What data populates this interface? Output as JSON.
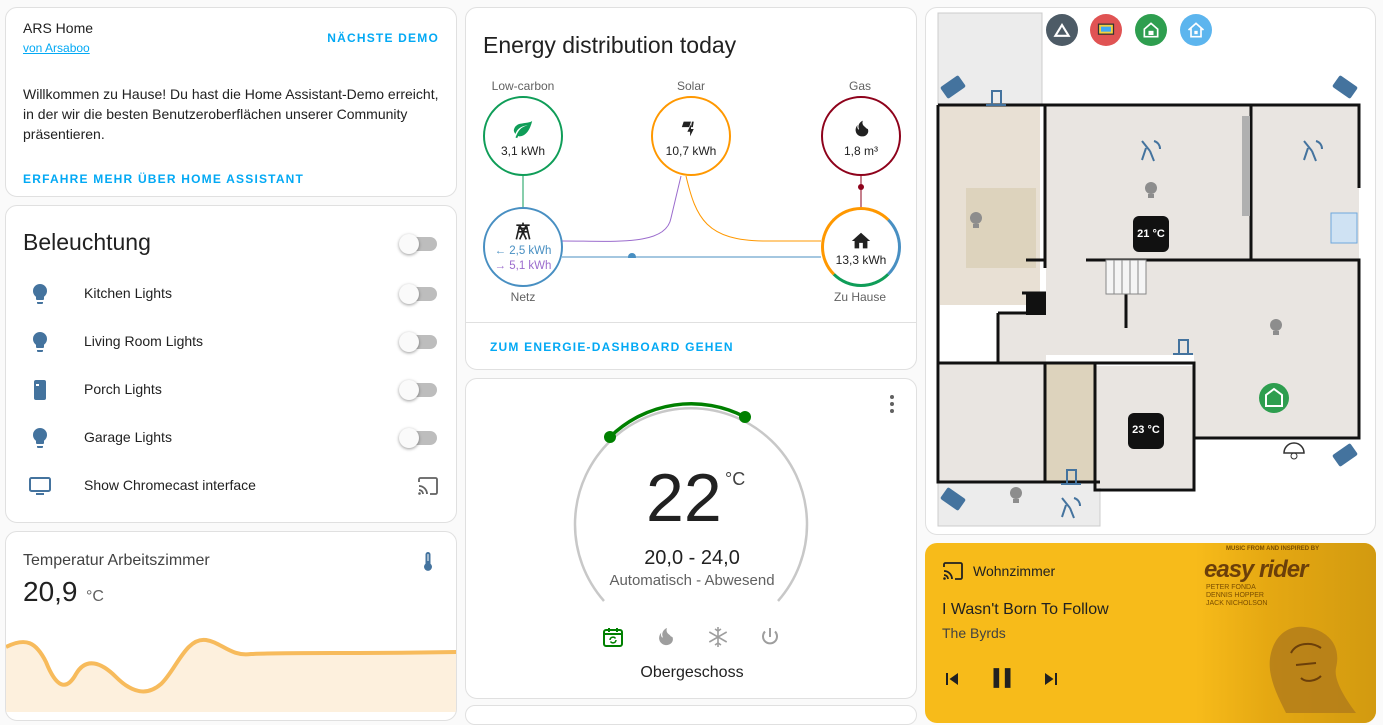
{
  "intro": {
    "title": "ARS Home",
    "author_link": "von Arsaboo",
    "next_demo": "NÄCHSTE DEMO",
    "description": "Willkommen zu Hause! Du hast die Home Assistant-Demo erreicht, in der wir die besten Benutzeroberflächen unserer Community präsentieren.",
    "learn_more": "ERFAHRE MEHR ÜBER HOME ASSISTANT"
  },
  "lights": {
    "title": "Beleuchtung",
    "items": [
      {
        "label": "Kitchen Lights",
        "icon": "lightbulb-icon"
      },
      {
        "label": "Living Room Lights",
        "icon": "lightbulb-icon"
      },
      {
        "label": "Porch Lights",
        "icon": "outdoor-lamp-icon"
      },
      {
        "label": "Garage Lights",
        "icon": "lightbulb-icon"
      },
      {
        "label": "Show Chromecast interface",
        "icon": "television-icon"
      }
    ]
  },
  "temperature": {
    "title": "Temperatur Arbeitszimmer",
    "value": "20,9",
    "unit": "°C"
  },
  "energy": {
    "title": "Energy distribution today",
    "low_carbon": {
      "label": "Low-carbon",
      "value": "3,1 kWh"
    },
    "solar": {
      "label": "Solar",
      "value": "10,7 kWh"
    },
    "gas": {
      "label": "Gas",
      "value": "1,8 m³"
    },
    "grid": {
      "label": "Netz",
      "import": "2,5 kWh",
      "export": "5,1 kWh"
    },
    "home": {
      "label": "Zu Hause",
      "value": "13,3 kWh"
    },
    "dashboard_link": "ZUM ENERGIE-DASHBOARD GEHEN"
  },
  "thermostat": {
    "target": "22",
    "unit": "°C",
    "range": "20,0 - 24,0",
    "mode_text": "Automatisch - Abwesend",
    "name": "Obergeschoss",
    "modes": [
      "calendar-sync-icon",
      "fire-icon",
      "snowflake-icon",
      "power-icon"
    ]
  },
  "floorplan": {
    "temp1": "21 °C",
    "temp2": "23 °C"
  },
  "media": {
    "source": "Wohnzimmer",
    "track": "I Wasn't Born To Follow",
    "artist": "The Byrds",
    "album_art_title": "easy rider",
    "album_art_top": "MUSIC FROM AND INSPIRED BY",
    "album_art_credits": [
      "PETER FONDA",
      "DENNIS HOPPER",
      "JACK NICHOLSON"
    ]
  },
  "colors": {
    "accent": "#03a9f4",
    "icon_blue": "#44739e",
    "low_carbon": "#0f9d58",
    "solar": "#ff9800",
    "gas": "#8e021b",
    "grid": "#488fc2",
    "media_bg": "#f7bb1a"
  }
}
